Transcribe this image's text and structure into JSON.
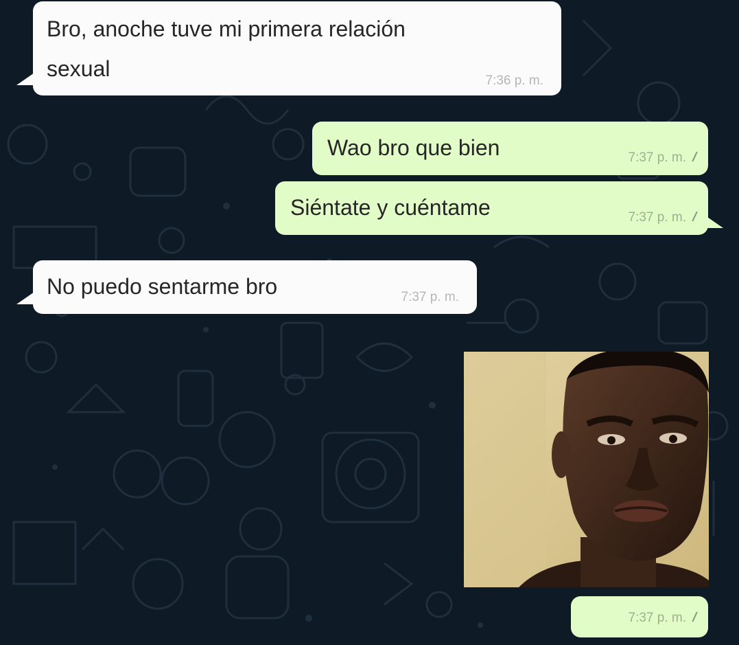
{
  "chat": {
    "messages": [
      {
        "direction": "incoming",
        "text": "Bro, anoche tuve mi primera relación",
        "text_line2": "sexual",
        "time": "7:36 p. m."
      },
      {
        "direction": "outgoing",
        "text": "Wao bro que bien",
        "time": "7:37 p. m.",
        "status_icon": "double-check-icon"
      },
      {
        "direction": "outgoing",
        "text": "Siéntate y cuéntame",
        "time": "7:37 p. m.",
        "status_icon": "double-check-icon"
      },
      {
        "direction": "incoming",
        "text": "No puedo sentarme bro",
        "time": "7:37 p. m."
      },
      {
        "direction": "outgoing",
        "type": "image",
        "image_icon": "man-face-photo",
        "time": "7:37 p. m.",
        "status_icon": "double-check-icon"
      }
    ]
  },
  "colors": {
    "background": "#0e1a26",
    "wallpaper_doodles": "#1e2d3a",
    "incoming_bubble": "#fbfbfb",
    "outgoing_bubble": "#e2fcc8"
  }
}
